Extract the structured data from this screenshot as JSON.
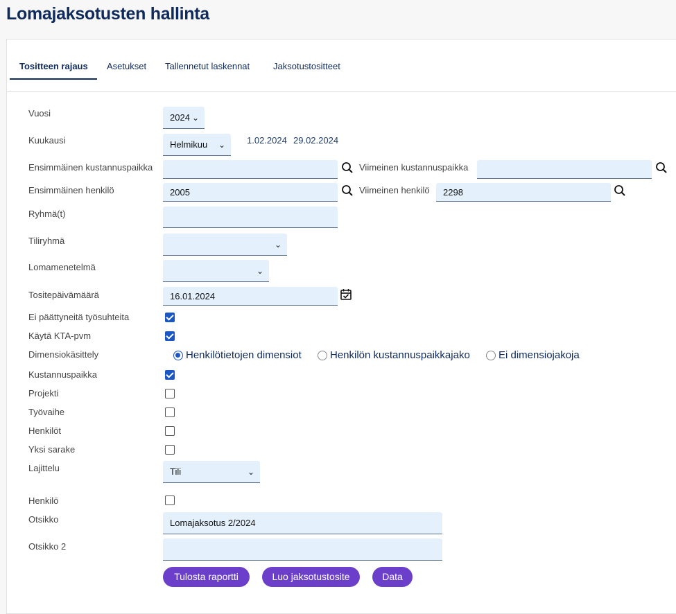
{
  "page_title": "Lomajaksotusten hallinta",
  "tabs": [
    {
      "label": "Tositteen rajaus"
    },
    {
      "label": "Asetukset"
    },
    {
      "label": "Tallennetut laskennat"
    },
    {
      "label": "Jaksotustositteet"
    }
  ],
  "form": {
    "vuosi": {
      "label": "Vuosi",
      "value": "2024"
    },
    "kuukausi": {
      "label": "Kuukausi",
      "value": "Helmikuu",
      "start": "1.02.2024",
      "end": "29.02.2024"
    },
    "ens_kp": {
      "label": "Ensimmäinen kustannuspaikka",
      "value": ""
    },
    "viim_kp": {
      "label": "Viimeinen kustannuspaikka",
      "value": ""
    },
    "ens_henk": {
      "label": "Ensimmäinen henkilö",
      "value": "2005"
    },
    "viim_henk": {
      "label": "Viimeinen henkilö",
      "value": "2298"
    },
    "ryhma": {
      "label": "Ryhmä(t)",
      "value": ""
    },
    "tiliryhma": {
      "label": "Tiliryhmä",
      "value": ""
    },
    "lomamenetelma": {
      "label": "Lomamenetelmä",
      "value": ""
    },
    "tositepvm": {
      "label": "Tositepäivämäärä",
      "value": "16.01.2024"
    },
    "ei_paattyneita": {
      "label": "Ei päättyneitä työsuhteita",
      "checked": true
    },
    "kta": {
      "label": "Käytä KTA-pvm",
      "checked": true
    },
    "dimensio": {
      "label": "Dimensiokäsittely",
      "options": [
        "Henkilötietojen dimensiot",
        "Henkilön kustannuspaikkajako",
        "Ei dimensiojakoja"
      ],
      "selected": 0
    },
    "kustannuspaikka": {
      "label": "Kustannuspaikka",
      "checked": true
    },
    "projekti": {
      "label": "Projekti",
      "checked": false
    },
    "tyovaihe": {
      "label": "Työvaihe",
      "checked": false
    },
    "henkilot": {
      "label": "Henkilöt",
      "checked": false
    },
    "yksi_sarake": {
      "label": "Yksi sarake",
      "checked": false
    },
    "lajittelu": {
      "label": "Lajittelu",
      "value": "Tili"
    },
    "henkilo": {
      "label": "Henkilö",
      "checked": false
    },
    "otsikko": {
      "label": "Otsikko",
      "value": "Lomajaksotus 2/2024"
    },
    "otsikko2": {
      "label": "Otsikko 2",
      "value": ""
    }
  },
  "buttons": {
    "tulosta": "Tulosta raportti",
    "luo": "Luo jaksotustosite",
    "data": "Data"
  },
  "colors": {
    "accent": "#6b3fc9",
    "title": "#0f2a5c",
    "field_bg": "#e4f0fc",
    "checkbox": "#1a56c4"
  }
}
